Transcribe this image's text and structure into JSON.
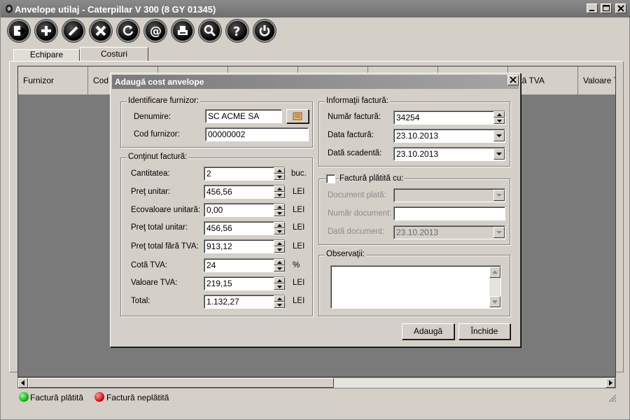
{
  "window": {
    "title": "Anvelope utilaj - Caterpillar  V 300 (8 GY 01345)"
  },
  "toolbar": {
    "buttons": [
      {
        "icon": "exit-icon"
      },
      {
        "icon": "add-icon"
      },
      {
        "icon": "edit-icon"
      },
      {
        "icon": "delete-icon"
      },
      {
        "icon": "refresh-icon"
      },
      {
        "icon": "email-icon"
      },
      {
        "icon": "print-icon"
      },
      {
        "icon": "search-icon"
      },
      {
        "icon": "help-icon"
      },
      {
        "icon": "power-icon"
      }
    ]
  },
  "tabs": [
    {
      "label": "Echipare",
      "active": false
    },
    {
      "label": "Costuri",
      "active": true
    }
  ],
  "grid": {
    "columns": [
      "Furnizor",
      "Cod f",
      "",
      "",
      "",
      "",
      "",
      "oltă TVA",
      "Valoare T"
    ]
  },
  "legend": {
    "paid": "Factură plătită",
    "unpaid": "Factură neplătită"
  },
  "dialog": {
    "title": "Adaugă cost anvelope",
    "supplier": {
      "legend": "Identificare furnizor:",
      "name_label": "Denumire:",
      "name_value": "SC ACME SA",
      "code_label": "Cod furnizor:",
      "code_value": "00000002"
    },
    "invoice_content": {
      "legend": "Conţinut factură:",
      "fields": [
        {
          "label": "Cantitatea:",
          "value": "2",
          "unit": "buc."
        },
        {
          "label": "Preţ unitar:",
          "value": "456,56",
          "unit": "LEI"
        },
        {
          "label": "Ecovaloare unitară:",
          "value": "0,00",
          "unit": "LEI"
        },
        {
          "label": "Preţ total unitar:",
          "value": "456,56",
          "unit": "LEI"
        },
        {
          "label": "Preţ total fără TVA:",
          "value": "913,12",
          "unit": "LEI"
        },
        {
          "label": "Cotă TVA:",
          "value": "24",
          "unit": "%"
        },
        {
          "label": "Valoare TVA:",
          "value": "219,15",
          "unit": "LEI"
        },
        {
          "label": "Total:",
          "value": "1.132,27",
          "unit": "LEI"
        }
      ]
    },
    "invoice_info": {
      "legend": "Informaţii factură:",
      "number_label": "Număr factură:",
      "number_value": "34254",
      "date_label": "Data factură:",
      "date_value": "23.10.2013",
      "due_label": "Dată scadentă:",
      "due_value": "23.10.2013"
    },
    "paid_with": {
      "checkbox_label": "Factură plătită cu:",
      "checked": false,
      "doc_type_label": "Document plată:",
      "doc_type_value": "",
      "doc_number_label": "Număr document:",
      "doc_number_value": "",
      "doc_date_label": "Dată document:",
      "doc_date_value": "23.10.2013"
    },
    "notes": {
      "legend": "Observaţii:",
      "value": ""
    },
    "add_button": "Adaugă",
    "close_button": "Închide"
  }
}
